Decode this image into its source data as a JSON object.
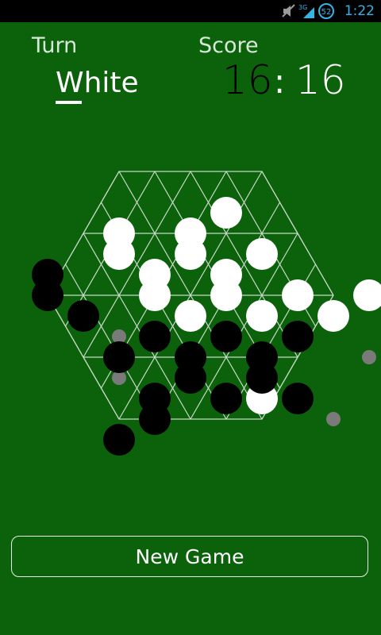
{
  "status_bar": {
    "time": "1:22",
    "battery_level": "52",
    "network": "3G"
  },
  "header": {
    "turn_label": "Turn",
    "turn_value": "White",
    "score_label": "Score",
    "score_black": "16",
    "score_separator": ":",
    "score_white": "16"
  },
  "board": {
    "shape": "hexagon",
    "side_length": 4,
    "colors": {
      "background": "#0b620b",
      "grid": "#c8d8c8",
      "white_piece": "#ffffff",
      "black_piece": "#000000",
      "hint_marker": "#7a7a7a"
    },
    "white_pieces": [
      [
        1,
        1
      ],
      [
        3,
        1
      ],
      [
        4,
        0
      ],
      [
        1,
        2
      ],
      [
        3,
        2
      ],
      [
        5,
        2
      ],
      [
        2,
        3
      ],
      [
        4,
        3
      ],
      [
        2,
        4
      ],
      [
        4,
        4
      ],
      [
        6,
        4
      ],
      [
        8,
        4
      ],
      [
        3,
        5
      ],
      [
        5,
        5
      ],
      [
        7,
        5
      ],
      [
        5,
        9
      ]
    ],
    "black_pieces": [
      [
        0,
        3
      ],
      [
        0,
        4
      ],
      [
        1,
        5
      ],
      [
        3,
        6
      ],
      [
        5,
        6
      ],
      [
        7,
        6
      ],
      [
        2,
        7
      ],
      [
        4,
        7
      ],
      [
        6,
        7
      ],
      [
        4,
        8
      ],
      [
        6,
        8
      ],
      [
        3,
        9
      ],
      [
        5,
        9
      ],
      [
        7,
        9
      ],
      [
        3,
        10
      ],
      [
        2,
        11
      ]
    ],
    "hint_markers": [
      [
        1,
        6
      ],
      [
        8,
        7
      ],
      [
        1,
        8
      ],
      [
        7,
        10
      ]
    ]
  },
  "actions": {
    "new_game_label": "New Game"
  }
}
